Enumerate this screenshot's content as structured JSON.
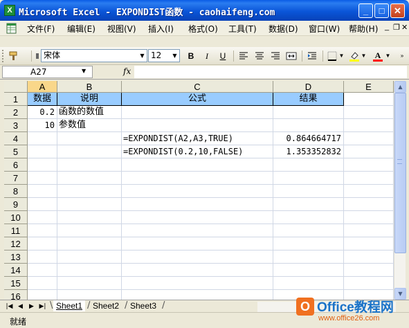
{
  "window": {
    "title": "Microsoft Excel - EXPONDIST函数 - caohaifeng.com",
    "app_icon": "X",
    "minimize": "_",
    "maximize": "□",
    "close": "✕"
  },
  "menu": {
    "items": [
      "文件(F)",
      "编辑(E)",
      "视图(V)",
      "插入(I)",
      "格式(O)",
      "工具(T)",
      "数据(D)",
      "窗口(W)",
      "帮助(H)"
    ],
    "doc_minimize": "_",
    "doc_restore": "❐",
    "doc_close": "✕"
  },
  "toolbar": {
    "font_name": "宋体",
    "font_size": "12",
    "bold": "B",
    "italic": "I",
    "underline": "U",
    "fill_color": "#ffff00",
    "font_color": "#ff0000"
  },
  "formula_bar": {
    "name_box": "A27",
    "fx": "fx",
    "formula": ""
  },
  "grid": {
    "columns": [
      "A",
      "B",
      "C",
      "D",
      "E"
    ],
    "rows": [
      "1",
      "2",
      "3",
      "4",
      "5",
      "6",
      "7",
      "8",
      "9",
      "10",
      "11",
      "12",
      "13",
      "14",
      "15",
      "16"
    ],
    "cells": {
      "A1": "数据",
      "B1": "说明",
      "C1": "公式",
      "D1": "结果",
      "A2": "0.2",
      "B2": "函数的数值",
      "A3": "10",
      "B3": "参数值",
      "C4": "=EXPONDIST(A2,A3,TRUE)",
      "D4": "0.864664717",
      "C5": "=EXPONDIST(0.2,10,FALSE)",
      "D5": "1.353352832"
    },
    "header_fill": "#99ccff"
  },
  "sheets": {
    "tabs": [
      "Sheet1",
      "Sheet2",
      "Sheet3"
    ],
    "active": "Sheet1"
  },
  "status": {
    "text": "就绪"
  },
  "watermark": {
    "title": "Office教程网",
    "url": "www.office26.com"
  }
}
